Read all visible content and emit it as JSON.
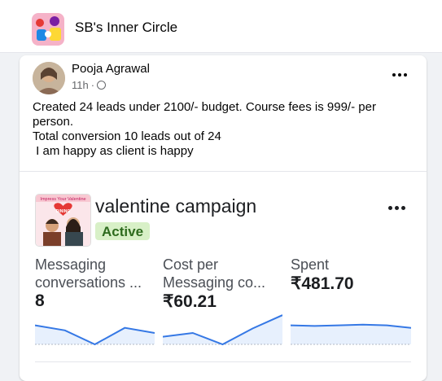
{
  "group": {
    "name": "SB's Inner Circle"
  },
  "post": {
    "author": "Pooja Agrawal",
    "time": "11h",
    "separator": "·",
    "text_lines": [
      "Created 24 leads under 2100/- budget. Course fees is 999/- per",
      "person.",
      "Total conversion 10 leads out of 24",
      " I am happy as client is happy"
    ]
  },
  "campaign": {
    "thumb_banner": "Impress Your Valentine",
    "thumb_label": "DINING",
    "title": "valentine campaign",
    "status": "Active",
    "metrics": [
      {
        "label_line1": "Messaging",
        "label_line2": "conversations ...",
        "value": "8",
        "trend": [
          3,
          2.2,
          0,
          2.6,
          1.8
        ]
      },
      {
        "label_line1": "Cost per",
        "label_line2": "Messaging co...",
        "value": "₹60.21",
        "trend": [
          1.2,
          1.8,
          0,
          2.5,
          4.6
        ]
      },
      {
        "label_line1": "Spent",
        "label_line2": "",
        "value": "₹481.70",
        "trend": [
          3,
          2.9,
          3,
          3.1,
          3,
          2.6
        ]
      }
    ]
  },
  "colors": {
    "accent": "#1877f2",
    "line": "#3578e5",
    "fill": "#e7f0fd",
    "status_bg": "#d8f0c7",
    "status_text": "#2e6b1e"
  },
  "icons": {
    "group_icon": "group-avatar-icon",
    "globe": "globe-icon",
    "more": "more-options-icon"
  }
}
